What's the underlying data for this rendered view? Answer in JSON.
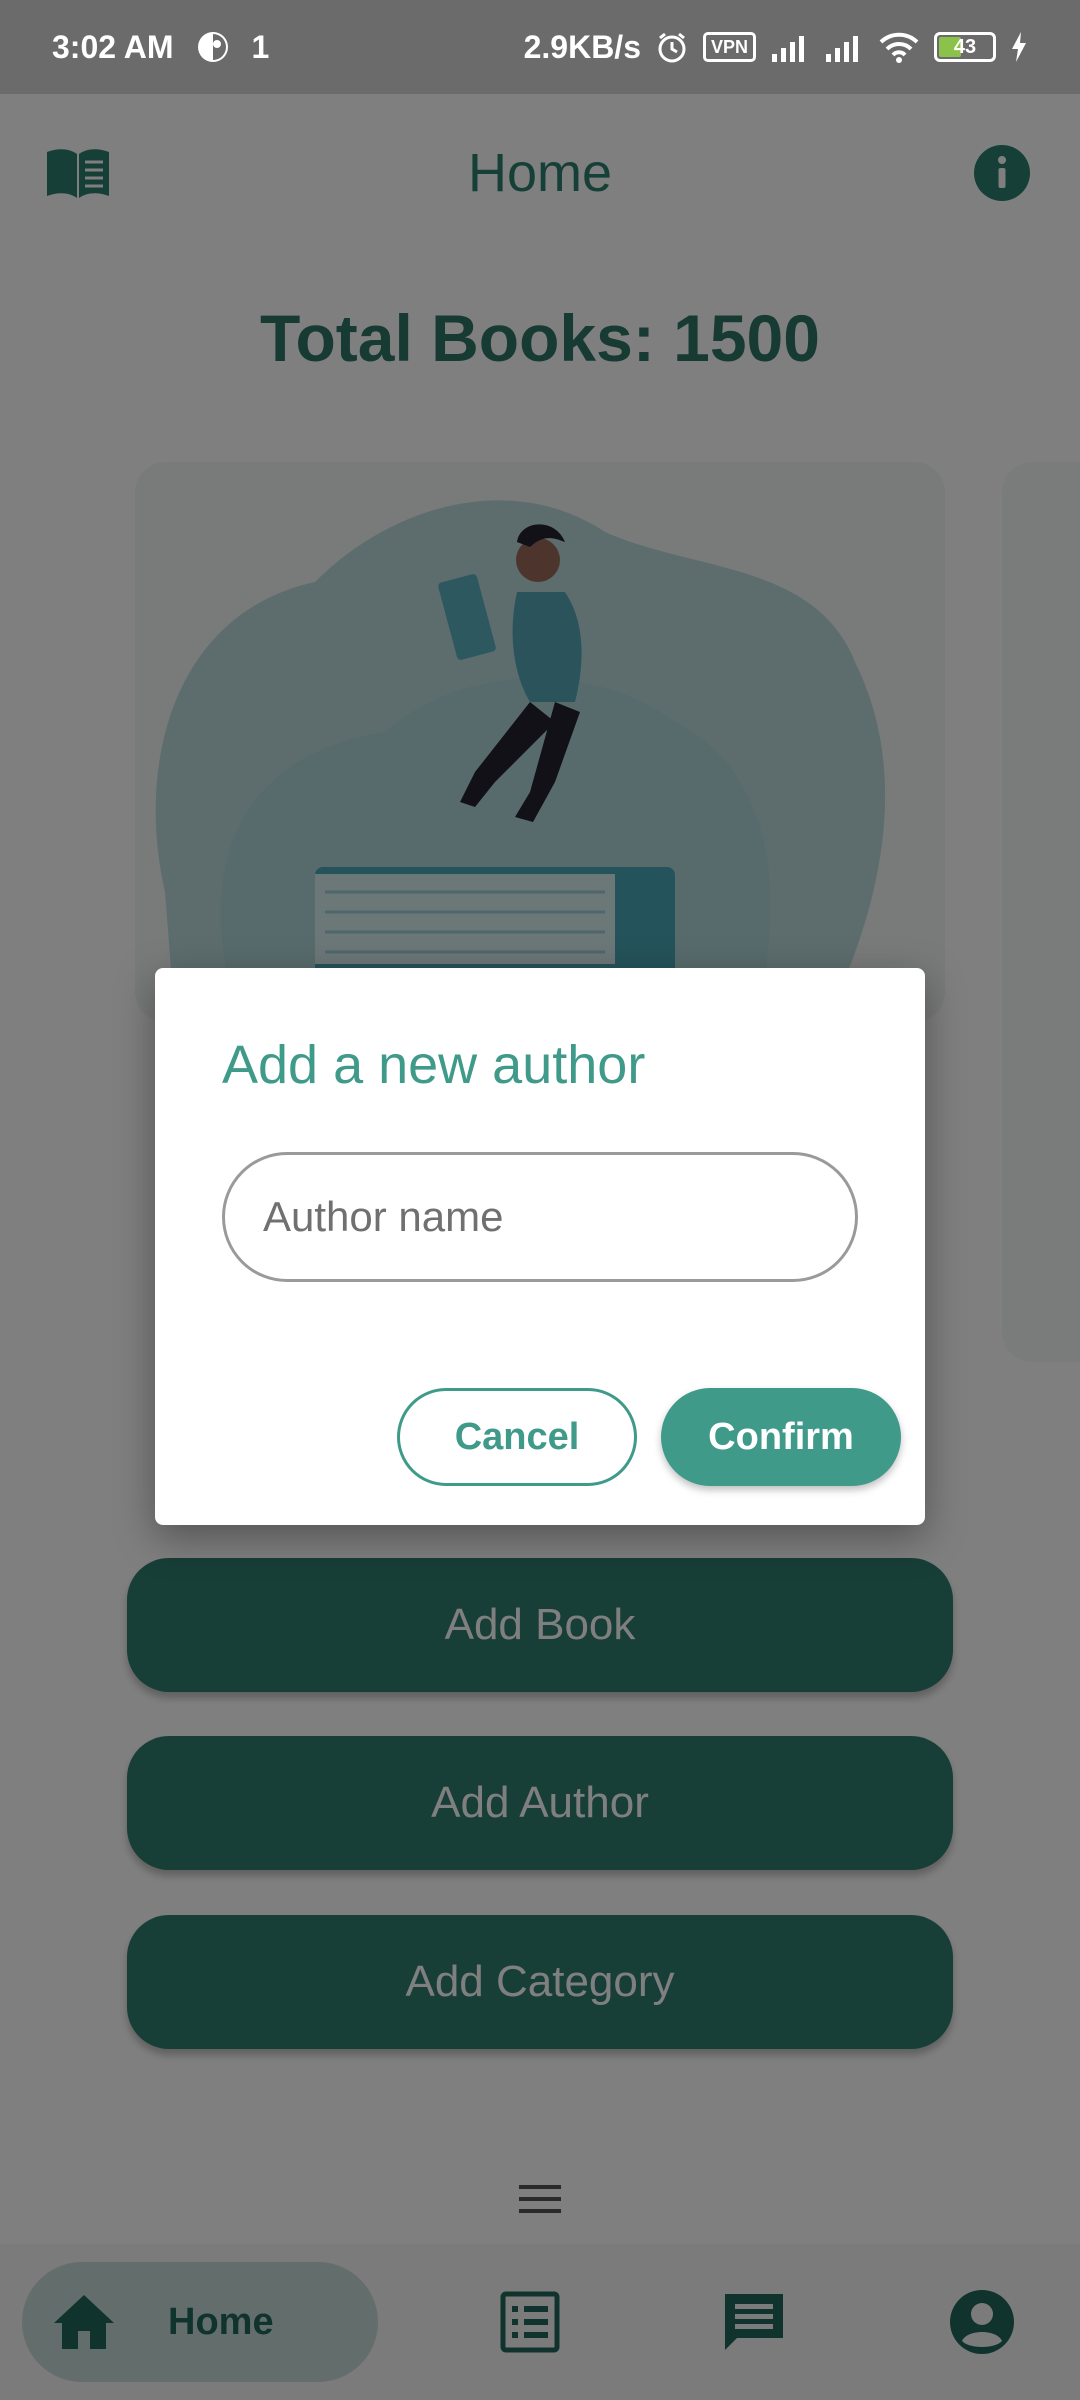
{
  "status_bar": {
    "time": "3:02 AM",
    "notif_count": "1",
    "net_speed": "2.9KB/s",
    "vpn_label": "VPN",
    "battery_level": "43"
  },
  "app_bar": {
    "title": "Home",
    "left_icon": "book-open-icon",
    "right_icon": "info-icon"
  },
  "main": {
    "total_books_label": "Total Books: 1500",
    "actions": [
      {
        "label": "Add Book"
      },
      {
        "label": "Add Author"
      },
      {
        "label": "Add Category"
      }
    ]
  },
  "dialog": {
    "title": "Add a new author",
    "input_placeholder": "Author name",
    "input_value": "",
    "cancel_label": "Cancel",
    "confirm_label": "Confirm"
  },
  "nav": {
    "items": [
      {
        "label": "Home",
        "icon": "home-icon",
        "selected": true
      },
      {
        "label": "",
        "icon": "list-icon"
      },
      {
        "label": "",
        "icon": "chat-icon"
      },
      {
        "label": "",
        "icon": "account-icon"
      }
    ]
  },
  "colors": {
    "primary": "#2e7d6e",
    "accent": "#3f9a8a",
    "title_text": "#2f7567"
  }
}
